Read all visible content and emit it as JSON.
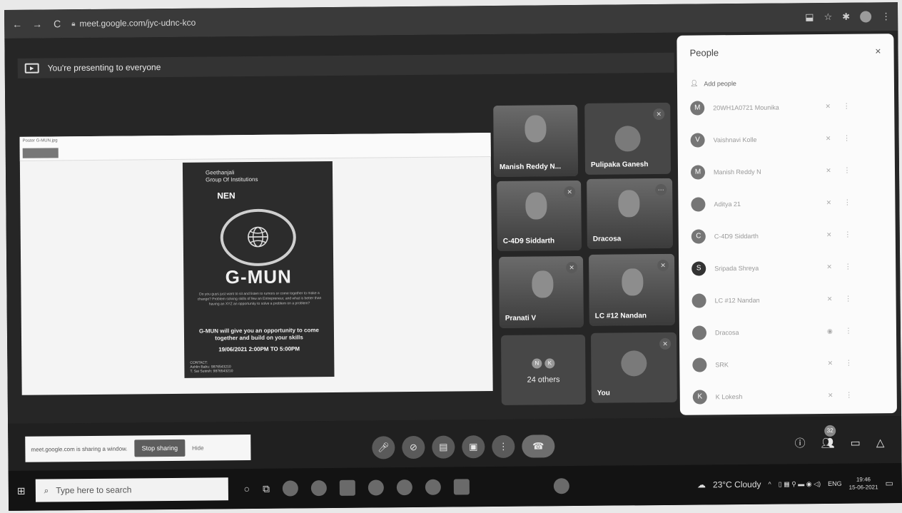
{
  "browser": {
    "url": "meet.google.com/jyc-udnc-kco",
    "nav": {
      "back": "←",
      "forward": "→",
      "reload": "C"
    },
    "right_icons": [
      "⬓",
      "☆",
      "✱"
    ]
  },
  "banner": {
    "text": "You're presenting to everyone"
  },
  "slide": {
    "title_small": "Poster G-MUN.jpg",
    "poster": {
      "institution": "Geethanjali\nGroup Of Institutions",
      "nen": "NEN",
      "title": "G-MUN",
      "paragraph": "Do you guys just want to sit and listen to rumors or come together to make a change? Problem solving skills of few an Entrepreneur, and what is better than having an XYZ an opportunity to solve a problem on a problem?",
      "headline": "G-MUN will give you an opportunity to come together and build on your skills",
      "date": "19/06/2021 2:00PM TO 5:00PM",
      "contact": "CONTACT:\nAshlin Babu: 9876543210\nT. Sai Sutesh: 9876543210"
    }
  },
  "tiles": [
    {
      "name": "Manish Reddy N...",
      "type": "video"
    },
    {
      "name": "Pulipaka Ganesh",
      "type": "avatar"
    },
    {
      "name": "C-4D9 Siddarth",
      "type": "video"
    },
    {
      "name": "Dracosa",
      "type": "video"
    },
    {
      "name": "Pranati V",
      "type": "video"
    },
    {
      "name": "LC #12 Nandan",
      "type": "video"
    },
    {
      "name": "24 others",
      "type": "others",
      "mini": [
        "N",
        "K"
      ]
    },
    {
      "name": "You",
      "type": "avatar"
    }
  ],
  "people": {
    "title": "People",
    "close": "×",
    "add_label": "Add people",
    "list": [
      {
        "initial": "M",
        "name": "20WH1A0721 Mounika",
        "menu": "⋮"
      },
      {
        "initial": "V",
        "name": "Vaishnavi Kolle",
        "menu": "⋮"
      },
      {
        "initial": "M",
        "name": "Manish Reddy N",
        "menu": "⋮"
      },
      {
        "initial": "",
        "name": "Aditya 21",
        "menu": "⋮"
      },
      {
        "initial": "C",
        "name": "C-4D9 Siddarth",
        "menu": "⋮"
      },
      {
        "initial": "S",
        "name": "Sripada Shreya",
        "menu": "⋮"
      },
      {
        "initial": "",
        "name": "LC #12 Nandan",
        "menu": "⋮"
      },
      {
        "initial": "",
        "name": "Dracosa",
        "menu": "⋮"
      },
      {
        "initial": "",
        "name": "SRK",
        "menu": "⋮"
      },
      {
        "initial": "K",
        "name": "K Lokesh",
        "menu": "⋮"
      }
    ]
  },
  "bottom": {
    "sharing_text": "meet.google.com is sharing a window.",
    "stop_label": "Stop sharing",
    "hide_label": "Hide",
    "people_count": "32"
  },
  "taskbar": {
    "search_placeholder": "Type here to search",
    "weather": "23°C Cloudy",
    "lang": "ENG",
    "time": "19:46",
    "date": "15-06-2021"
  }
}
